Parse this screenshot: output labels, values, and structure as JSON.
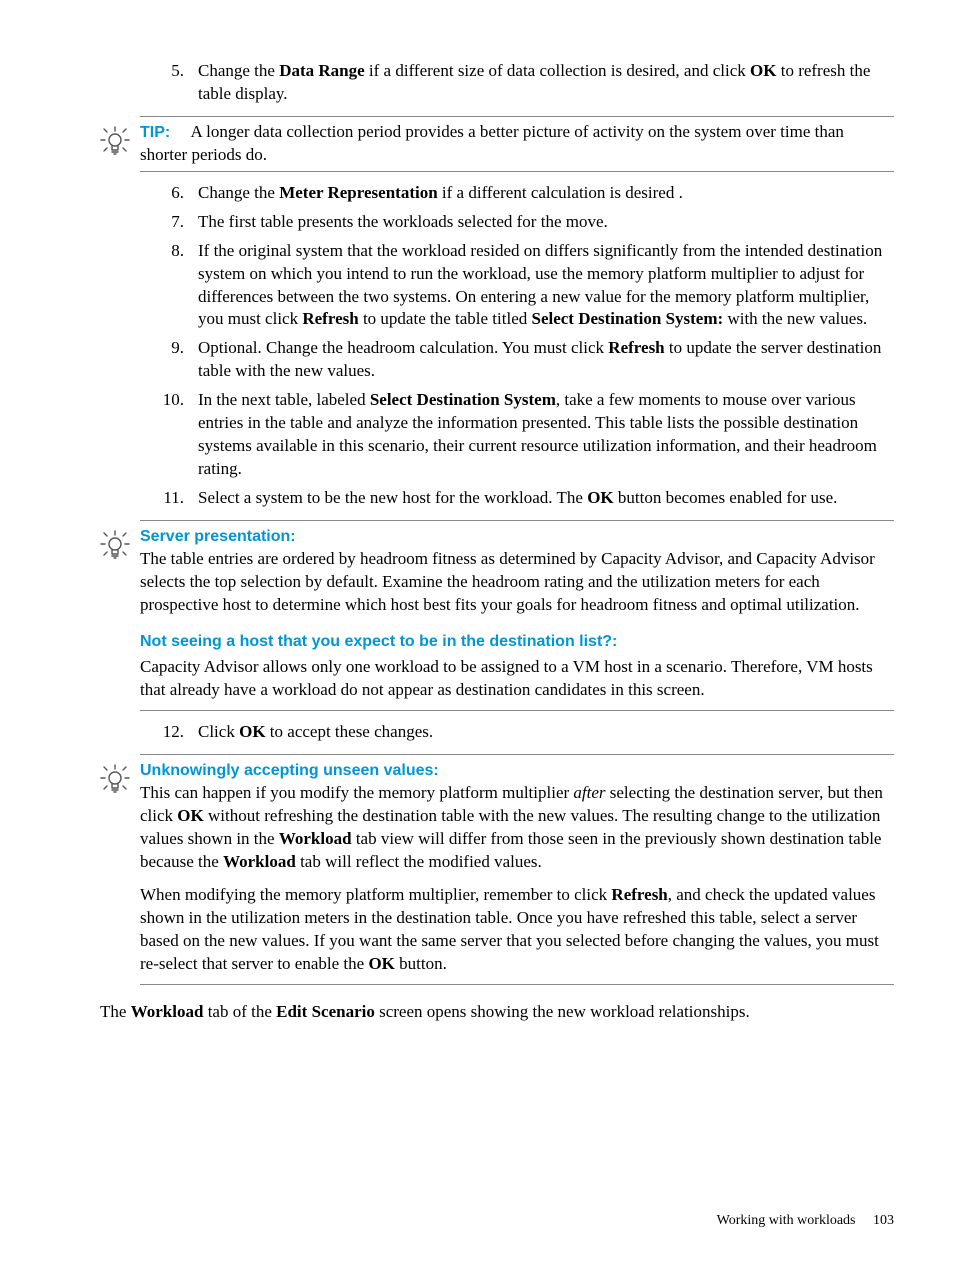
{
  "steps_a": [
    {
      "n": "5.",
      "html": "Change the <b>Data Range</b> if a different size of data collection is desired, and click <b>OK</b> to refresh the table display."
    }
  ],
  "tip1": {
    "label": "TIP:",
    "text": "A longer data collection period provides a better picture of activity on the system over time than shorter periods do."
  },
  "steps_b": [
    {
      "n": "6.",
      "html": "Change the <b>Meter Representation</b> if a different calculation is desired ."
    },
    {
      "n": "7.",
      "html": "The first table presents the workloads selected for the move."
    },
    {
      "n": "8.",
      "html": "If the original system that the workload resided on differs significantly from the intended destination system on which you intend to run the workload, use the memory platform multiplier to adjust for differences between the two systems. On entering a new value for the memory platform multiplier, you must click <b>Refresh</b> to update the table titled <b>Select Destination System:</b> with the new values."
    },
    {
      "n": "9.",
      "html": "Optional. Change the headroom calculation. You must click <b>Refresh</b> to update the server destination table with the new values."
    },
    {
      "n": "10.",
      "html": "In the next table, labeled <b>Select Destination System</b>, take a few moments to mouse over various entries in the table and analyze the information presented. This table lists the possible destination systems available in this scenario, their current resource utilization information, and their headroom rating."
    },
    {
      "n": "11.",
      "html": "Select a system to be the new host for the workload. The <b>OK</b> button becomes enabled for use."
    }
  ],
  "tip2": {
    "label": "Server presentation:",
    "body1": "The table entries are ordered by headroom fitness as determined by Capacity Advisor, and Capacity Advisor selects the top selection by default. Examine the headroom rating and the utilization meters for each prospective host to determine which host best fits your goals for headroom fitness and optimal utilization.",
    "sub": "Not seeing a host that you expect to be in the destination list?:",
    "body2": "Capacity Advisor allows only one workload to be assigned to a VM host in a scenario. Therefore, VM hosts that already have a workload do not appear as destination candidates in this screen."
  },
  "steps_c": [
    {
      "n": "12.",
      "html": "Click <b>OK</b> to accept these changes."
    }
  ],
  "tip3": {
    "label": "Unknowingly accepting unseen values:",
    "body1_html": "This can happen if you modify the memory platform multiplier <i>after</i> selecting the destination server, but then click <b>OK</b> without refreshing the destination table with the new values. The resulting change to the utilization values shown in the <b>Workload</b> tab view will differ from those seen in the previously shown destination table because the <b>Workload</b> tab will reflect the modified values.",
    "body2_html": "When modifying the memory platform multiplier, remember to click <b>Refresh</b>, and check the updated values shown in the utilization meters in the destination table. Once you have refreshed this table, select a server based on the new values. If you want the same server that you selected before changing the values, you must re-select that server to enable the <b>OK</b> button."
  },
  "closing_html": "The <b>Workload</b> tab of the <b>Edit Scenario</b> screen opens showing the new workload relationships.",
  "footer": {
    "section": "Working with workloads",
    "page": "103"
  },
  "icon_name": "tip-bulb-icon"
}
